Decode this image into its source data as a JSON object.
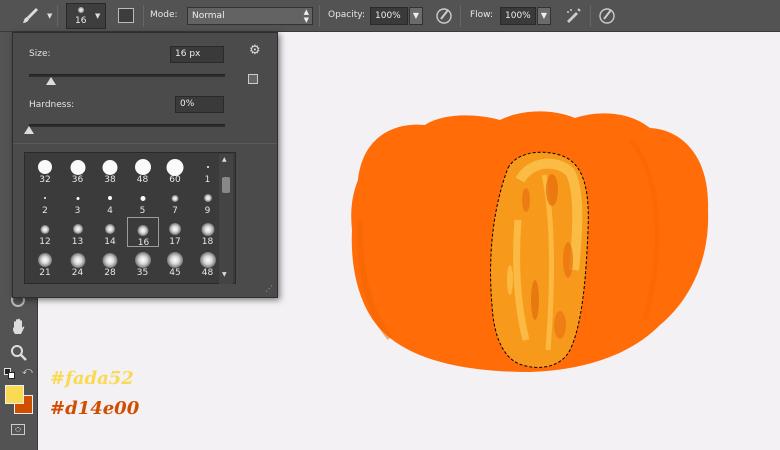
{
  "options_bar": {
    "brush_size": "16",
    "mode_label": "Mode:",
    "mode_value": "Normal",
    "opacity_label": "Opacity:",
    "opacity_value": "100%",
    "flow_label": "Flow:",
    "flow_value": "100%"
  },
  "brush_picker": {
    "size_label": "Size:",
    "size_value": "16 px",
    "size_level_pct": 6,
    "hardness_label": "Hardness:",
    "hardness_value": "0%",
    "hardness_level_pct": 0,
    "presets": [
      {
        "label": "32",
        "kind": "hard",
        "d": 14
      },
      {
        "label": "36",
        "kind": "hard",
        "d": 15
      },
      {
        "label": "38",
        "kind": "hard",
        "d": 15
      },
      {
        "label": "48",
        "kind": "hard",
        "d": 16
      },
      {
        "label": "60",
        "kind": "hard",
        "d": 17
      },
      {
        "label": "1",
        "kind": "hard",
        "d": 2
      },
      {
        "label": "2",
        "kind": "hard",
        "d": 2
      },
      {
        "label": "3",
        "kind": "hard",
        "d": 3
      },
      {
        "label": "4",
        "kind": "hard",
        "d": 4
      },
      {
        "label": "5",
        "kind": "hard",
        "d": 5
      },
      {
        "label": "7",
        "kind": "soft",
        "d": 7
      },
      {
        "label": "9",
        "kind": "soft",
        "d": 8
      },
      {
        "label": "12",
        "kind": "soft",
        "d": 9
      },
      {
        "label": "13",
        "kind": "soft",
        "d": 10
      },
      {
        "label": "14",
        "kind": "soft",
        "d": 10
      },
      {
        "label": "16",
        "kind": "soft",
        "d": 11
      },
      {
        "label": "17",
        "kind": "soft",
        "d": 12
      },
      {
        "label": "18",
        "kind": "soft",
        "d": 13
      },
      {
        "label": "21",
        "kind": "soft",
        "d": 14
      },
      {
        "label": "24",
        "kind": "soft",
        "d": 15
      },
      {
        "label": "28",
        "kind": "soft",
        "d": 15
      },
      {
        "label": "35",
        "kind": "soft",
        "d": 16
      },
      {
        "label": "45",
        "kind": "soft",
        "d": 16
      },
      {
        "label": "48",
        "kind": "soft",
        "d": 16
      }
    ],
    "selected_label": "16"
  },
  "swatches": {
    "foreground_hex": "#fada52",
    "background_hex": "#d14e00",
    "foreground_label": "#fada52",
    "background_label": "#d14e00"
  },
  "colors": {
    "pumpkin": "#ff6c08",
    "pumpkin_dark": "#f05f00",
    "stripe_light": "#fbc04a",
    "stripe_mid": "#f79a1c",
    "canvas_bg": "#f3f1f4"
  },
  "icons": [
    "brush-icon",
    "airbrush-icon",
    "tablet-pressure-icon",
    "hand-icon",
    "zoom-icon",
    "gear-icon",
    "new-preset-icon",
    "quickmask-icon",
    "swap-colors-icon",
    "default-colors-icon"
  ]
}
